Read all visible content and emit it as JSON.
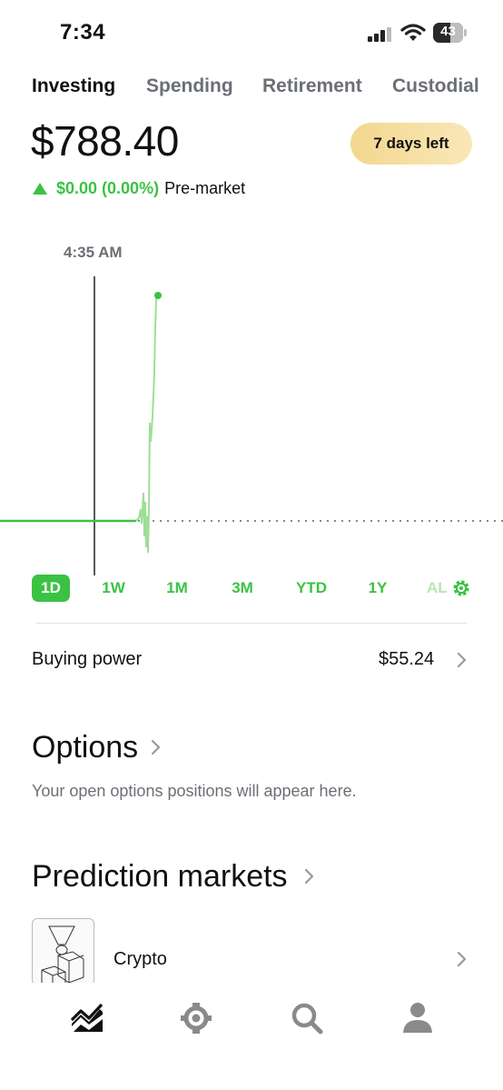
{
  "status_bar": {
    "time": "7:34",
    "battery": "43"
  },
  "tabs": [
    {
      "label": "Investing",
      "active": true
    },
    {
      "label": "Spending",
      "active": false
    },
    {
      "label": "Retirement",
      "active": false
    },
    {
      "label": "Custodial",
      "active": false
    }
  ],
  "portfolio": {
    "value": "$788.40",
    "trial_label": "7 days left",
    "change": "$0.00 (0.00%)",
    "change_note": "Pre-market"
  },
  "chart": {
    "scrub_time": "4:35 AM",
    "line_color": "#3bc243"
  },
  "ranges": [
    {
      "label": "1D",
      "active": true
    },
    {
      "label": "1W",
      "active": false
    },
    {
      "label": "1M",
      "active": false
    },
    {
      "label": "3M",
      "active": false
    },
    {
      "label": "YTD",
      "active": false
    },
    {
      "label": "1Y",
      "active": false
    },
    {
      "label": "AL",
      "active": false
    }
  ],
  "buying_power": {
    "label": "Buying power",
    "value": "$55.24"
  },
  "options": {
    "title": "Options",
    "subtitle": "Your open options positions will appear here."
  },
  "prediction_markets": {
    "title": "Prediction markets",
    "items": [
      {
        "label": "Crypto"
      }
    ]
  },
  "bottom_nav": [
    {
      "icon": "investing-chart-icon",
      "active": true
    },
    {
      "icon": "crypto-coin-icon",
      "active": false
    },
    {
      "icon": "search-icon",
      "active": false
    },
    {
      "icon": "account-person-icon",
      "active": false
    }
  ],
  "colors": {
    "accent_green": "#3bc243",
    "muted_text": "#6b6f75",
    "trial_gold": "#f3d78f"
  }
}
